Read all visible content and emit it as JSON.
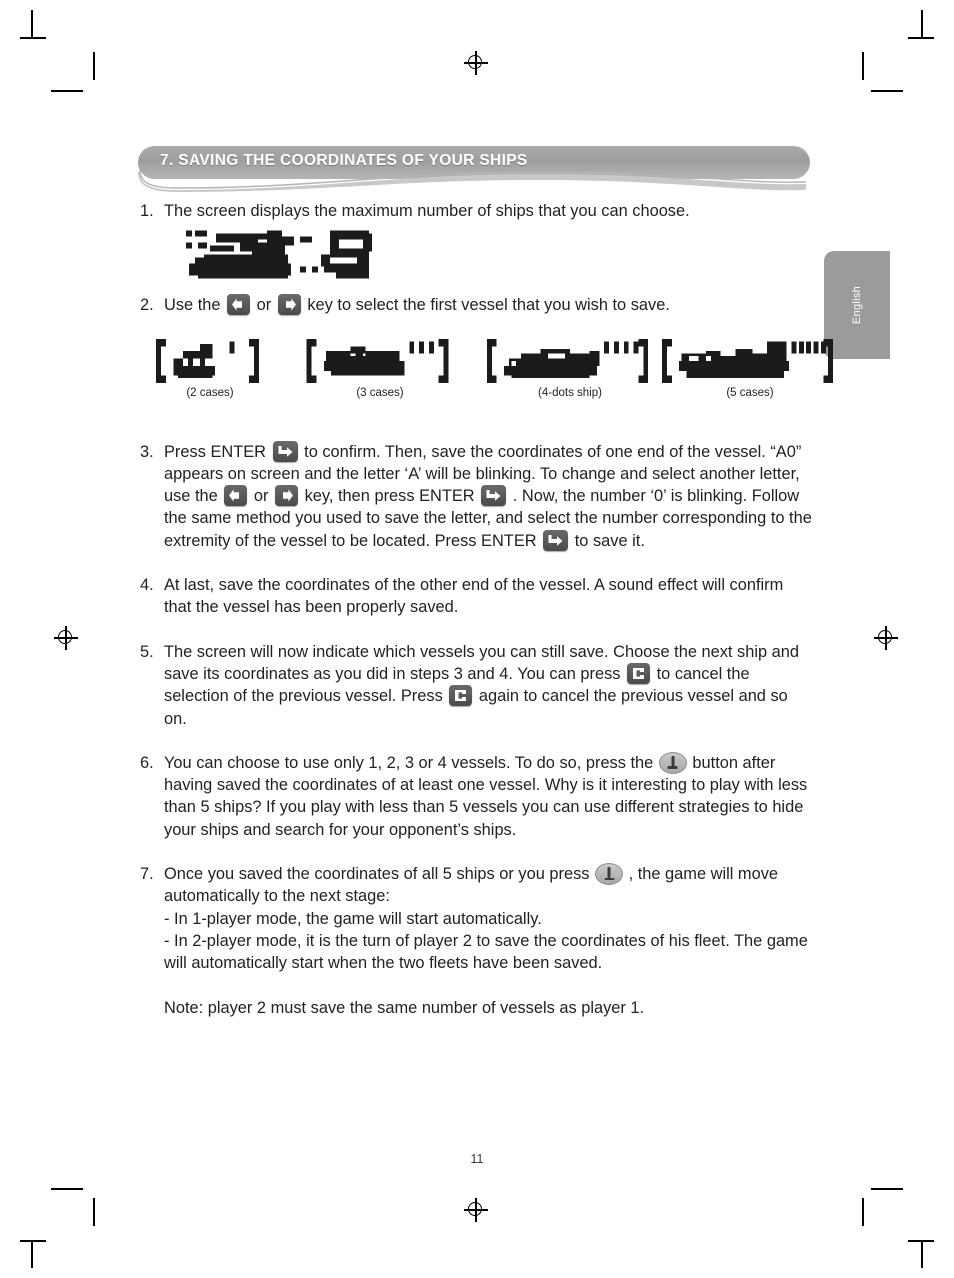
{
  "page": {
    "number": "11",
    "language_tab": "English",
    "section_title": "7. SAVING THE COORDINATES OF YOUR SHIPS",
    "accent_gray": "#9e9e9e",
    "ink": "#231f20"
  },
  "items": [
    {
      "num": "1.",
      "text": "The screen displays the maximum number of ships that you can choose."
    },
    {
      "num": "2.",
      "seg1": "Use the",
      "icon_left": "arrow-left-key-icon",
      "seg2": "or",
      "icon_right": "arrow-right-key-icon",
      "seg3": "key to select the first vessel that you wish to save."
    },
    {
      "num": "3.",
      "seg1": "Press ENTER",
      "icon_enter_1": "enter-key-icon",
      "seg2": "to confirm. Then, save the coordinates of one end of the vessel. “A0” appears on screen and the letter ‘A’ will be blinking. To change and select another letter, use the",
      "icon_left": "arrow-left-key-icon",
      "seg3": "or",
      "icon_right": "arrow-right-key-icon",
      "seg4": "key, then press ENTER",
      "icon_enter_2": "enter-key-icon",
      "seg5": ". Now, the number ‘0’ is blinking. Follow the same method you used to save the letter, and select the number corresponding to the extremity of the vessel to be located. Press ENTER",
      "icon_enter_3": "enter-key-icon",
      "seg6": "to save it."
    },
    {
      "num": "4.",
      "text": "At last, save the coordinates of the other end of the vessel. A sound effect will confirm that the vessel has been properly saved."
    },
    {
      "num": "5.",
      "seg1": "The screen will now indicate which vessels you can still save. Choose the next ship and save its coordinates as you did in steps 3 and 4. You can press",
      "icon_cancel_1": "cancel-c-key-icon",
      "seg2": "to cancel the selection of the previous vessel. Press",
      "icon_cancel_2": "cancel-c-key-icon",
      "seg3": "again to cancel the previous vessel and so on."
    },
    {
      "num": "6.",
      "seg1": "You can choose to use only 1, 2, 3 or 4 vessels. To do so, press the",
      "icon_oval": "oval-enter-button-icon",
      "seg2": "button after having saved the coordinates of at least one vessel. Why is it interesting to play with less than 5 ships? If you play with less than 5 vessels you can use different strategies to hide your ships and search for your opponent’s ships."
    },
    {
      "num": "7.",
      "seg1": "Once you saved the coordinates of all 5 ships or you press",
      "icon_oval": "oval-enter-button-icon",
      "seg2": ", the game will move automatically to the next stage:",
      "line2": "- In 1-player mode, the game will start automatically.",
      "line3": "- In 2-player mode, it is the turn of player 2 to save the coordinates of his fleet. The game will automatically start when the two fleets have been saved."
    }
  ],
  "note": "Note: player 2 must save the same number of vessels as player 1.",
  "lcd_display": {
    "name": "lcd-ship-count-display",
    "description": "pixel LCD showing ship graphic and the number 5",
    "value": "5"
  },
  "ships": [
    {
      "caption": "(2 cases)",
      "dots": 1,
      "name": "ship-2-cases"
    },
    {
      "caption": "(3 cases)",
      "dots": 3,
      "name": "ship-3-cases"
    },
    {
      "caption": "(4-dots ship)",
      "dots": 4,
      "name": "ship-4-dots"
    },
    {
      "caption": "(5 cases)",
      "dots": 5,
      "name": "ship-5-cases"
    }
  ]
}
